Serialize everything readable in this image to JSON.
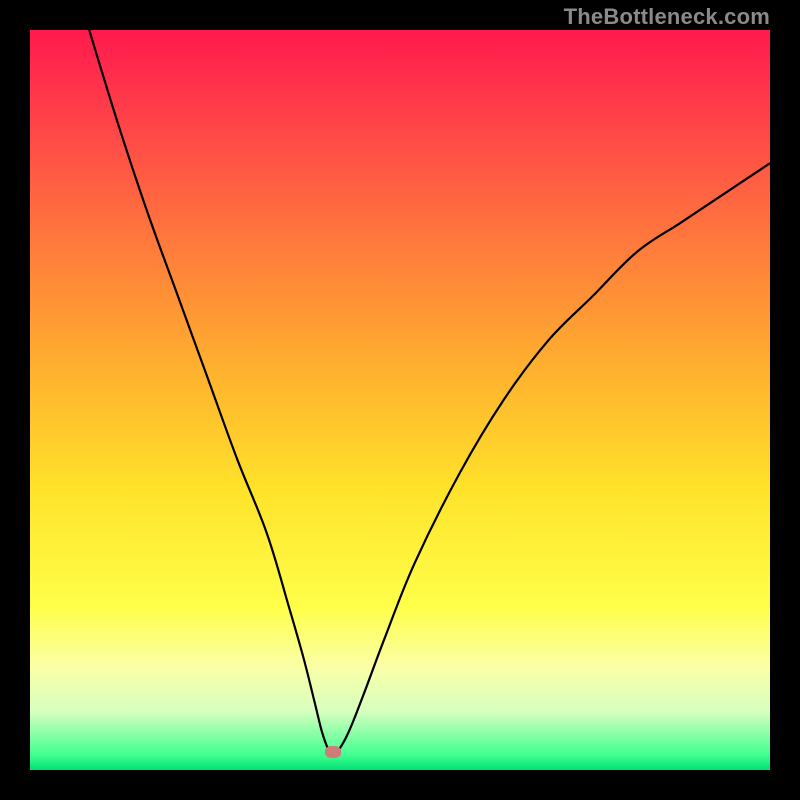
{
  "watermark": "TheBottleneck.com",
  "chart_data": {
    "type": "line",
    "title": "",
    "xlabel": "",
    "ylabel": "",
    "xlim": [
      0,
      100
    ],
    "ylim": [
      0,
      100
    ],
    "grid": false,
    "series": [
      {
        "name": "curve",
        "color": "#000000",
        "x": [
          8,
          12,
          16,
          20,
          24,
          28,
          32,
          35,
          37,
          38.5,
          39.5,
          40.5,
          41.5,
          43,
          45,
          48,
          52,
          58,
          64,
          70,
          76,
          82,
          88,
          94,
          100
        ],
        "y": [
          100,
          87,
          75,
          64,
          53,
          42,
          32,
          22,
          15,
          9,
          5,
          2.5,
          2.5,
          5,
          10,
          18,
          28,
          40,
          50,
          58,
          64,
          70,
          74,
          78,
          82
        ]
      }
    ],
    "flat_segment": {
      "x0": 39.5,
      "x1": 41.5,
      "y": 2.5
    },
    "marker": {
      "x": 41,
      "y": 2.5,
      "color": "#cf7b77"
    },
    "background_gradient": [
      {
        "stop": 0.0,
        "color": "#ff1a4d"
      },
      {
        "stop": 0.1,
        "color": "#ff3b4a"
      },
      {
        "stop": 0.25,
        "color": "#ff6d3f"
      },
      {
        "stop": 0.45,
        "color": "#ffae2f"
      },
      {
        "stop": 0.62,
        "color": "#ffe22a"
      },
      {
        "stop": 0.78,
        "color": "#ffff4a"
      },
      {
        "stop": 0.86,
        "color": "#fbffa6"
      },
      {
        "stop": 0.92,
        "color": "#d8ffc0"
      },
      {
        "stop": 0.98,
        "color": "#40ff90"
      },
      {
        "stop": 1.0,
        "color": "#00e074"
      }
    ]
  },
  "dimensions": {
    "outer": 800,
    "inner": 740,
    "margin": 30
  }
}
